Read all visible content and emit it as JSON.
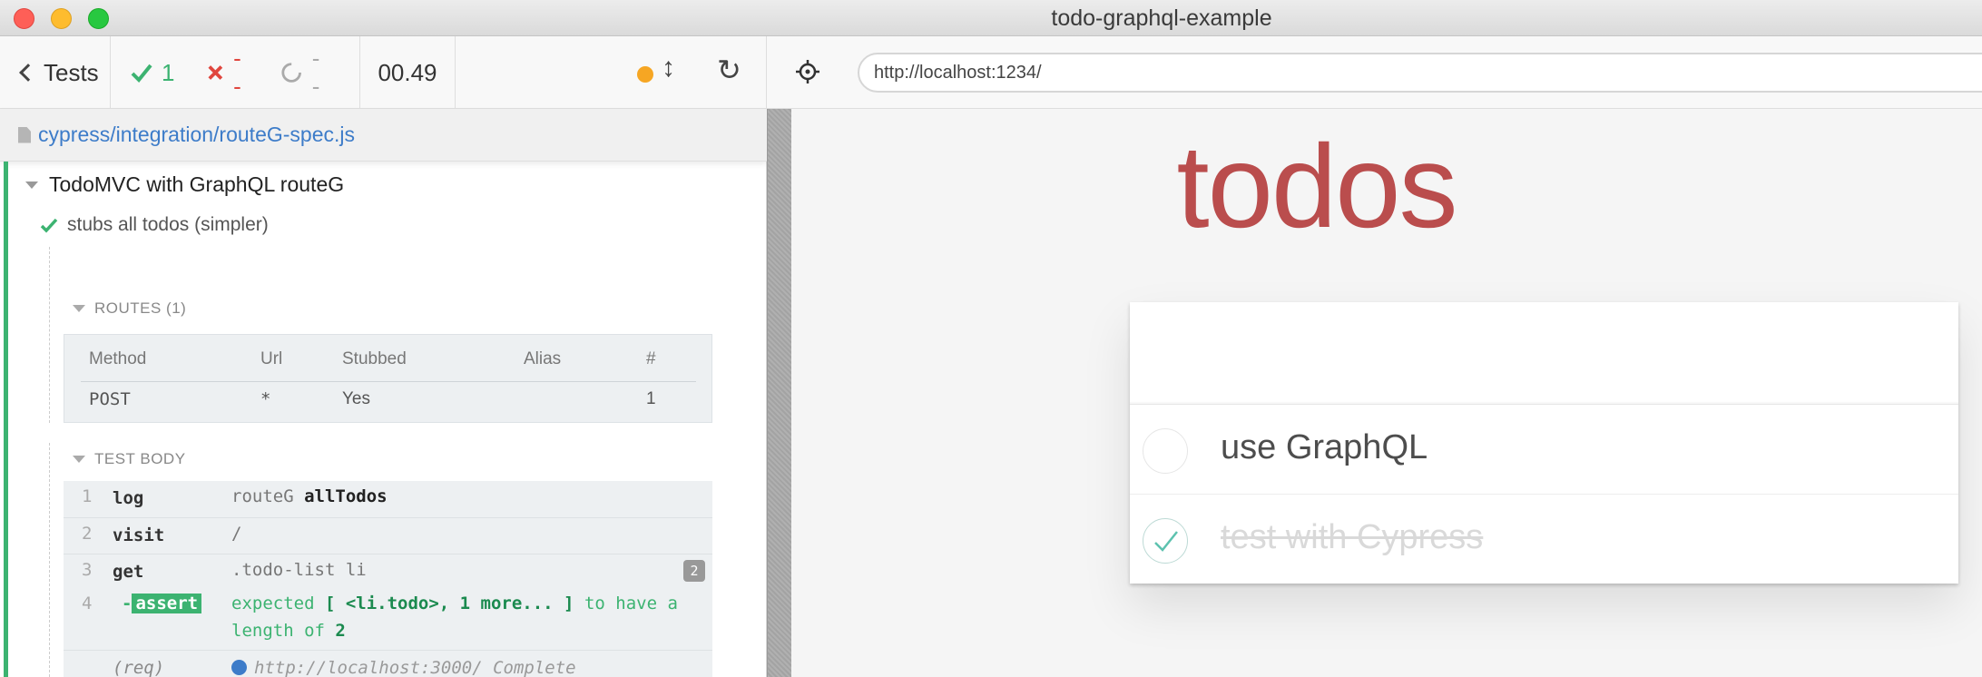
{
  "window": {
    "title": "todo-graphql-example"
  },
  "reporter": {
    "tests_button": "Tests",
    "stats": {
      "passed": "1",
      "failed": "--",
      "pending": "--",
      "duration": "00.49"
    },
    "spec_file": "cypress/integration/routeG-spec.js",
    "suite_title": "TodoMVC with GraphQL routeG",
    "test_title": "stubs all todos (simpler)",
    "routes": {
      "header": "ROUTES (1)",
      "columns": [
        "Method",
        "Url",
        "Stubbed",
        "Alias",
        "#"
      ],
      "rows": [
        {
          "method": "POST",
          "url": "*",
          "stubbed": "Yes",
          "alias": "",
          "count": "1"
        }
      ]
    },
    "test_body": {
      "header": "TEST BODY",
      "commands": [
        {
          "num": "1",
          "name": "log",
          "msg_prefix": "routeG ",
          "msg_strong": "allTodos"
        },
        {
          "num": "2",
          "name": "visit",
          "msg": "/"
        },
        {
          "num": "3",
          "name": "get",
          "msg": ".todo-list li",
          "badge": "2"
        },
        {
          "num": "4",
          "name": "-",
          "badge": "assert",
          "msg_a": "expected ",
          "msg_b": "[ <li.todo>, 1 more... ]",
          "msg_c": " to have a length of ",
          "msg_d": "2"
        }
      ],
      "request": {
        "label": "(req)",
        "msg": "http://localhost:3000/ Complete"
      }
    }
  },
  "aut": {
    "url": "http://localhost:1234/",
    "app_title": "todos",
    "todos": [
      {
        "label": "use GraphQL",
        "completed": false
      },
      {
        "label": "test with Cypress",
        "completed": true
      }
    ]
  },
  "colors": {
    "pass": "#3cb371",
    "fail": "#e0463e",
    "accent": "#3d7cc9",
    "todos_title": "#af2f2f"
  }
}
